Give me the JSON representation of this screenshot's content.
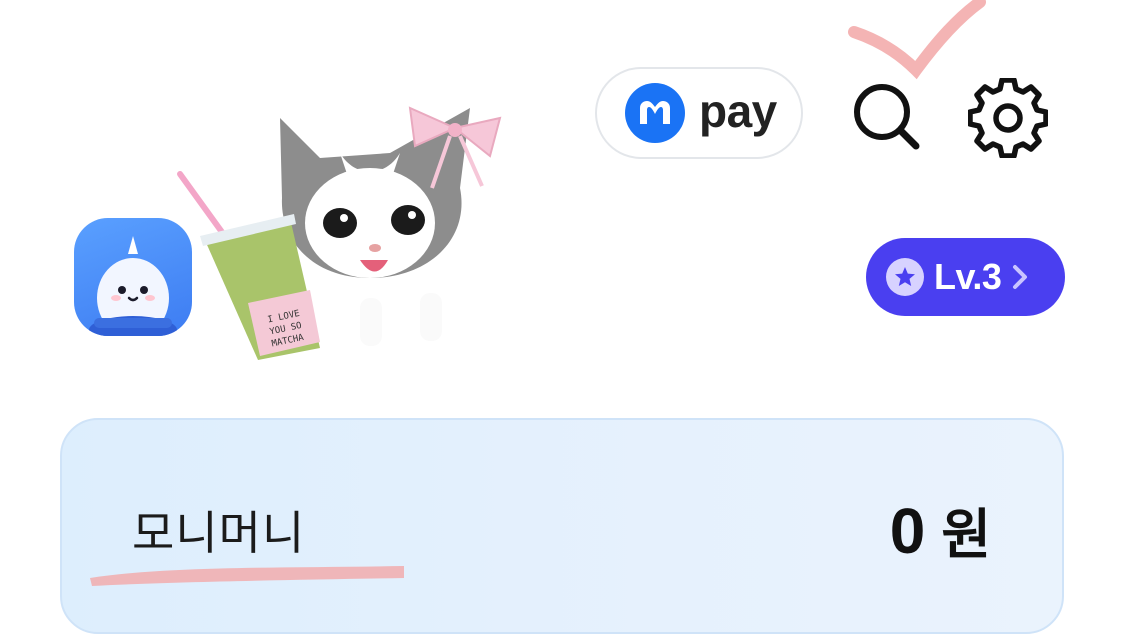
{
  "header": {
    "pay_label": "pay",
    "pay_icon": "kakao-pay-logo",
    "search_icon": "search-icon",
    "settings_icon": "gear-icon",
    "accent_pay": "#1a73f5"
  },
  "profile": {
    "avatar_icon": "narwhal-character",
    "sticker": "cat-with-matcha-sticker",
    "sticker_cup_text": "I LOVE YOU SO MATCHA"
  },
  "level": {
    "label": "Lv.3",
    "color": "#4a3ff0"
  },
  "money": {
    "label": "모니머니",
    "amount": "0",
    "unit": "원"
  },
  "annotations": {
    "check_color": "#f2a7a7",
    "underline_color": "#f2a7a7"
  }
}
